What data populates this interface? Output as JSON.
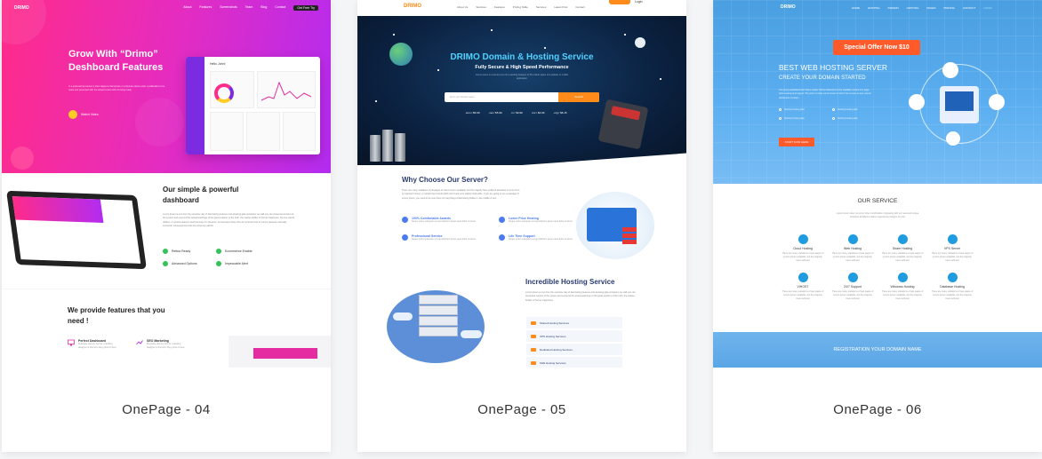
{
  "cards": [
    {
      "caption": "OnePage - 04",
      "logo": "DRIMO",
      "nav": [
        "About",
        "Features",
        "Screenshots",
        "Team",
        "Blog",
        "Contact",
        "Get Free Try"
      ],
      "hero_title": "Grow With “Drimo” Deshboard Features",
      "hero_text": "In a professional context it often happens that private or corporate clients order a publication to be made and presented with the actual content still not being ready.",
      "watch_label": "Watch Video",
      "dash_hello": "Hello John!",
      "section2_title": "Our simple & powerful dashboard",
      "section2_text": "Lorem Ipsum is one from the secretive day of fascinating pleasure and amazing gala occasions we stall you can presented content of the system and expound the actual teachings of the great explorer of the truth, the master-builder of human happiness. No one rejects, dislikes, or avoids pleasure itself because it is pleasure, but because those who do not know how to pursue pleasure rationally encounter consequences that are extremely painful.",
      "checks": [
        "Retina Ready",
        "Ecommerce Enable",
        "Advanced Options",
        "Impeccable Alert"
      ],
      "section3_title": "We provide features that you need !",
      "features": [
        {
          "title": "Perfect Dashboard",
          "text": "Fluctuate dummy text for a landing designer is this term they point of view"
        },
        {
          "title": "SEO Marketing",
          "text": "Fluctuate dummy text for a landing designer is this term they point of view"
        }
      ]
    },
    {
      "caption": "OnePage - 05",
      "logo": "DRIMO",
      "nav": [
        "About Us",
        "Services",
        "Features",
        "Pricing Table",
        "Services",
        "Latest Post",
        "Contact"
      ],
      "register_label": "Register",
      "login_label": "Login",
      "hero_title": "DRIMO Domain & Hosting Service",
      "hero_sub": "Fully Secure & High Speed Performance",
      "hero_text": "Lorem ipsum is a dummy text for a landing designer to fill a blank space of a website or mobile application",
      "search_placeholder": "Enter your domain name...",
      "search_button": "Search",
      "tlds": [
        ".com / $5.99",
        ".net / $5.99",
        ".in / $3.99",
        ".inc / $4.99",
        ".org / $6.15"
      ],
      "why_title": "Why Choose Our Server?",
      "why_text": "There are many variations of passages of Lorem Ipsum available, but the majority have suffered alteration in some form, by injected humour, or randomised words which don't look even slightly believable. If you are going to use a passage of Lorem Ipsum, you need to be sure there isn't anything embarrassing hidden in the middle of text.",
      "features": [
        {
          "title": "100% Comfortable Awards",
          "text": "Neque porro quisquam est qui dolorem ipsum quia dolor sit amet"
        },
        {
          "title": "Lower Price Hosting",
          "text": "Neque porro quisquam est qui dolorem ipsum quia dolor sit amet"
        },
        {
          "title": "Professional Service",
          "text": "Neque porro quisquam est qui dolorem ipsum quia dolor sit amet"
        },
        {
          "title": "Life Time Support",
          "text": "Neque porro quisquam est qui dolorem ipsum quia dolor sit amet"
        }
      ],
      "hosting_title": "Incredible Hosting Service",
      "hosting_text": "Lorem Ipsum is one from the secretive day of fascinating pleasure and amazing gala occasions we stall you can presented content of the system and expound the actual teachings of the great explorer of the truth, the master-builder of human happiness.",
      "hosting_list": [
        "Shared Hosting Services",
        "VPS Hosting Services",
        "Dedicated Hosting Services",
        "SSD Hosting Services"
      ]
    },
    {
      "caption": "OnePage - 06",
      "logo": "DRIMO",
      "nav": [
        "HOME",
        "HOSTING",
        "DOMAIN",
        "HOSTING",
        "PAGES",
        "PRICING",
        "CONTACT",
        "LOGIN"
      ],
      "offer": "Special Offer Now $10",
      "hero_title": "BEST WEB HOSTING SERVER",
      "hero_sub": "CREATE YOUR DOMAIN STARTED",
      "hero_text": "It is a long established fact that a reader will be distracted by the readable content of a page when looking at its layout. The point of using Lorem Ipsum is that it has a more-or-less normal distribution of letters.",
      "list": [
        "Starting hosting plan",
        "Starting hosting plan",
        "Starting hosting plan",
        "Starting hosting plan"
      ],
      "cta": "START NOW HERE",
      "service_title": "OUR SERVICE",
      "service_text": "Lorem Ipsum does not occur often combination originating with our reserved tongue locations all failed to deliver ingeniously designs of units",
      "services": [
        {
          "title": "Cloud Hosting",
          "text": "There are many variations of pas sages of Lorem Ipsum available, but the majority have suffered"
        },
        {
          "title": "Web Hosting",
          "text": "There are many variations of pas sages of Lorem Ipsum available, but the majority have suffered"
        },
        {
          "title": "Share Hosting",
          "text": "There are many variations of pas sages of Lorem Ipsum available, but the majority have suffered"
        },
        {
          "title": "VPS Server",
          "text": "There are many variations of pas sages of Lorem Ipsum available, but the majority have suffered"
        },
        {
          "title": "VIHOST",
          "text": "There are many variations of pas sages of Lorem Ipsum available, but the majority have suffered"
        },
        {
          "title": "24/7 Support",
          "text": "There are many variations of pas sages of Lorem Ipsum available, but the majority have suffered"
        },
        {
          "title": "Windows Hosting",
          "text": "There are many variations of pas sages of Lorem Ipsum available, but the majority have suffered"
        },
        {
          "title": "Database Hosting",
          "text": "There are many variations of pas sages of Lorem Ipsum available, but the majority have suffered"
        }
      ],
      "band": "REGISTRATION YOUR DOMAIN NAME"
    }
  ],
  "colors": {
    "card1_pink": "#ff2b8a",
    "card1_purple": "#b32cf0",
    "card2_navy": "#0b2140",
    "card2_orange": "#ff8c1a",
    "card2_cyan": "#4fd1ff",
    "card3_blue": "#4a9fe0",
    "card3_orange": "#ff5a2a"
  }
}
